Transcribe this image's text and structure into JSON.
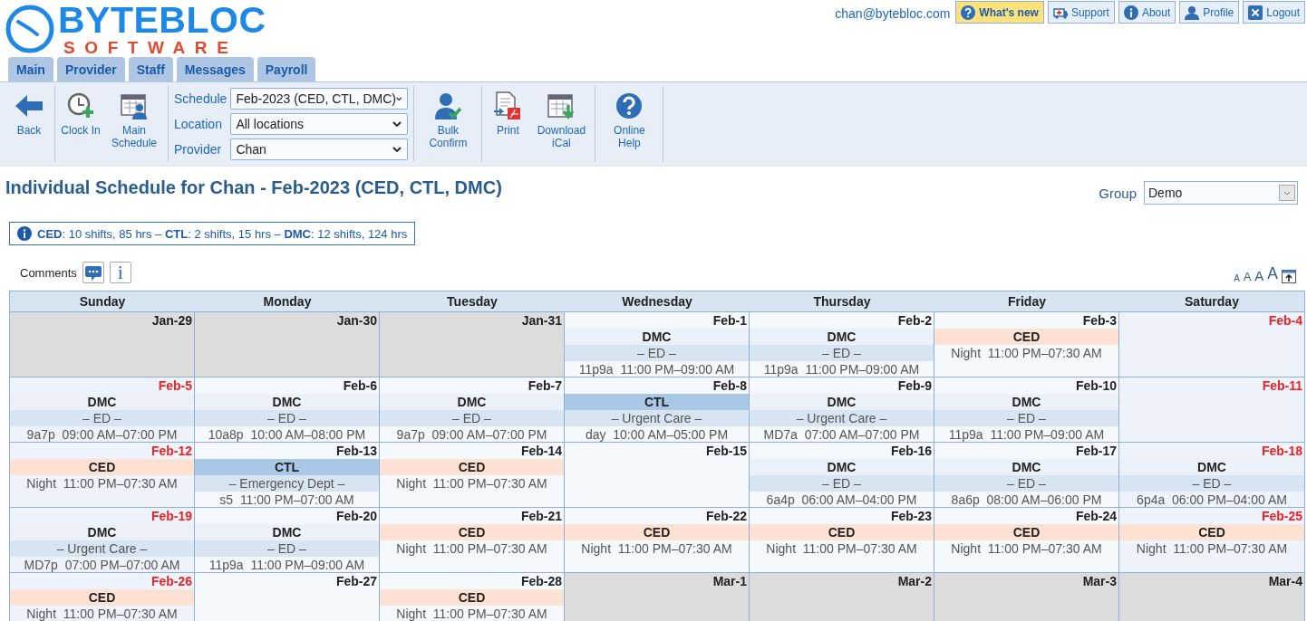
{
  "header": {
    "logo": {
      "title": "BYTEBLOC",
      "subtitle": "SOFTWARE"
    },
    "user_email": "chan@bytebloc.com",
    "buttons": [
      {
        "label": "What's new",
        "highlighted": true
      },
      {
        "label": "Support",
        "highlighted": false
      },
      {
        "label": "About",
        "highlighted": false
      },
      {
        "label": "Profile",
        "highlighted": false
      },
      {
        "label": "Logout",
        "highlighted": false
      }
    ]
  },
  "tabs": [
    {
      "label": "Main",
      "selected": false
    },
    {
      "label": "Provider",
      "selected": false
    },
    {
      "label": "Staff",
      "selected": false
    },
    {
      "label": "Messages",
      "selected": false
    },
    {
      "label": "Payroll",
      "selected": false
    }
  ],
  "toolbar": [
    {
      "kind": "buttons",
      "items": [
        "Back"
      ]
    },
    {
      "kind": "buttons",
      "items": [
        "Clock In",
        "Main Schedule"
      ]
    },
    {
      "kind": "filters",
      "fields": [
        {
          "label": "Schedule",
          "value": "Feb-2023 (CED, CTL, DMC)"
        },
        {
          "label": "Location",
          "value": "All locations"
        },
        {
          "label": "Provider",
          "value": "Chan"
        }
      ]
    },
    {
      "kind": "buttons",
      "items": [
        "Bulk Confirm"
      ]
    },
    {
      "kind": "buttons",
      "items": [
        "Print",
        "Download iCal"
      ]
    },
    {
      "kind": "buttons",
      "items": [
        "Online Help"
      ]
    }
  ],
  "title": "Individual Schedule for Chan - Feb-2023 (CED, CTL, DMC)",
  "group": {
    "label": "Group",
    "value": "Demo"
  },
  "summary": "**CED**: 10 shifts, 85 hrs – **CTL**: 2 shifts, 15 hrs – **DMC**: 12 shifts, 124 hrs",
  "comments": {
    "label": "Comments",
    "info_button": "i"
  },
  "font_size_options": [
    "A",
    "A",
    "A",
    "A"
  ],
  "calendar": {
    "weekdays": [
      "Sunday",
      "Monday",
      "Tuesday",
      "Wednesday",
      "Thursday",
      "Friday",
      "Saturday"
    ],
    "weeks": [
      [
        {
          "date": "Jan-29",
          "weekend": false,
          "outside": true
        },
        {
          "date": "Jan-30",
          "weekend": false,
          "outside": true
        },
        {
          "date": "Jan-31",
          "weekend": false,
          "outside": true
        },
        {
          "date": "Feb-1",
          "weekend": false,
          "outside": false,
          "shifts": [
            {
              "site": "DMC",
              "color": "#eaf1f8",
              "department": "– ED –",
              "code": "11p9a",
              "time": "11:00 PM–09:00 AM"
            }
          ]
        },
        {
          "date": "Feb-2",
          "weekend": false,
          "outside": false,
          "shifts": [
            {
              "site": "DMC",
              "color": "#eaf1f8",
              "department": "– ED –",
              "code": "11p9a",
              "time": "11:00 PM–09:00 AM"
            }
          ]
        },
        {
          "date": "Feb-3",
          "weekend": false,
          "outside": false,
          "shifts": [
            {
              "site": "CED",
              "color": "#fde2d4",
              "code": "Night",
              "time": "11:00 PM–07:30 AM"
            }
          ]
        },
        {
          "date": "Feb-4",
          "weekend": true,
          "outside": false
        }
      ],
      [
        {
          "date": "Feb-5",
          "weekend": true,
          "outside": false,
          "shifts": [
            {
              "site": "DMC",
              "color": "#eaf1f8",
              "department": "– ED –",
              "code": "9a7p",
              "time": "09:00 AM–07:00 PM"
            }
          ]
        },
        {
          "date": "Feb-6",
          "weekend": false,
          "outside": false,
          "shifts": [
            {
              "site": "DMC",
              "color": "#eaf1f8",
              "department": "– ED –",
              "code": "10a8p",
              "time": "10:00 AM–08:00 PM"
            }
          ]
        },
        {
          "date": "Feb-7",
          "weekend": false,
          "outside": false,
          "shifts": [
            {
              "site": "DMC",
              "color": "#eaf1f8",
              "department": "– ED –",
              "code": "9a7p",
              "time": "09:00 AM–07:00 PM"
            }
          ]
        },
        {
          "date": "Feb-8",
          "weekend": false,
          "outside": false,
          "shifts": [
            {
              "site": "CTL",
              "color": "#a9c8e6",
              "department": "– Urgent Care –",
              "code": "day",
              "time": "10:00 AM–05:00 PM"
            }
          ]
        },
        {
          "date": "Feb-9",
          "weekend": false,
          "outside": false,
          "shifts": [
            {
              "site": "DMC",
              "color": "#eaf1f8",
              "department": "– Urgent Care –",
              "code": "MD7a",
              "time": "07:00 AM–07:00 PM"
            }
          ]
        },
        {
          "date": "Feb-10",
          "weekend": false,
          "outside": false,
          "shifts": [
            {
              "site": "DMC",
              "color": "#eaf1f8",
              "department": "– ED –",
              "code": "11p9a",
              "time": "11:00 PM–09:00 AM"
            }
          ]
        },
        {
          "date": "Feb-11",
          "weekend": true,
          "outside": false
        }
      ],
      [
        {
          "date": "Feb-12",
          "weekend": true,
          "outside": false,
          "shifts": [
            {
              "site": "CED",
              "color": "#fde2d4",
              "code": "Night",
              "time": "11:00 PM–07:30 AM"
            }
          ]
        },
        {
          "date": "Feb-13",
          "weekend": false,
          "outside": false,
          "shifts": [
            {
              "site": "CTL",
              "color": "#a9c8e6",
              "department": "– Emergency Dept –",
              "code": "s5",
              "time": "11:00 PM–07:00 AM"
            }
          ]
        },
        {
          "date": "Feb-14",
          "weekend": false,
          "outside": false,
          "shifts": [
            {
              "site": "CED",
              "color": "#fde2d4",
              "code": "Night",
              "time": "11:00 PM–07:30 AM"
            }
          ]
        },
        {
          "date": "Feb-15",
          "weekend": false,
          "outside": false
        },
        {
          "date": "Feb-16",
          "weekend": false,
          "outside": false,
          "shifts": [
            {
              "site": "DMC",
              "color": "#eaf1f8",
              "department": "– ED –",
              "code": "6a4p",
              "time": "06:00 AM–04:00 PM"
            }
          ]
        },
        {
          "date": "Feb-17",
          "weekend": false,
          "outside": false,
          "shifts": [
            {
              "site": "DMC",
              "color": "#eaf1f8",
              "department": "– ED –",
              "code": "8a6p",
              "time": "08:00 AM–06:00 PM"
            }
          ]
        },
        {
          "date": "Feb-18",
          "weekend": true,
          "outside": false,
          "shifts": [
            {
              "site": "DMC",
              "color": "#eaf1f8",
              "department": "– ED –",
              "code": "6p4a",
              "time": "06:00 PM–04:00 AM"
            }
          ]
        }
      ],
      [
        {
          "date": "Feb-19",
          "weekend": true,
          "outside": false,
          "shifts": [
            {
              "site": "DMC",
              "color": "#eaf1f8",
              "department": "– Urgent Care –",
              "code": "MD7p",
              "time": "07:00 PM–07:00 AM"
            }
          ]
        },
        {
          "date": "Feb-20",
          "weekend": false,
          "outside": false,
          "shifts": [
            {
              "site": "DMC",
              "color": "#eaf1f8",
              "department": "– ED –",
              "code": "11p9a",
              "time": "11:00 PM–09:00 AM"
            }
          ]
        },
        {
          "date": "Feb-21",
          "weekend": false,
          "outside": false,
          "shifts": [
            {
              "site": "CED",
              "color": "#fde2d4",
              "code": "Night",
              "time": "11:00 PM–07:30 AM"
            }
          ]
        },
        {
          "date": "Feb-22",
          "weekend": false,
          "outside": false,
          "shifts": [
            {
              "site": "CED",
              "color": "#fde2d4",
              "code": "Night",
              "time": "11:00 PM–07:30 AM"
            }
          ]
        },
        {
          "date": "Feb-23",
          "weekend": false,
          "outside": false,
          "shifts": [
            {
              "site": "CED",
              "color": "#fde2d4",
              "code": "Night",
              "time": "11:00 PM–07:30 AM"
            }
          ]
        },
        {
          "date": "Feb-24",
          "weekend": false,
          "outside": false,
          "shifts": [
            {
              "site": "CED",
              "color": "#fde2d4",
              "code": "Night",
              "time": "11:00 PM–07:30 AM"
            }
          ]
        },
        {
          "date": "Feb-25",
          "weekend": true,
          "outside": false,
          "shifts": [
            {
              "site": "CED",
              "color": "#fde2d4",
              "code": "Night",
              "time": "11:00 PM–07:30 AM"
            }
          ]
        }
      ],
      [
        {
          "date": "Feb-26",
          "weekend": true,
          "outside": false,
          "shifts": [
            {
              "site": "CED",
              "color": "#fde2d4",
              "code": "Night",
              "time": "11:00 PM–07:30 AM"
            }
          ]
        },
        {
          "date": "Feb-27",
          "weekend": false,
          "outside": false
        },
        {
          "date": "Feb-28",
          "weekend": false,
          "outside": false,
          "shifts": [
            {
              "site": "CED",
              "color": "#fde2d4",
              "code": "Night",
              "time": "11:00 PM–07:30 AM"
            }
          ]
        },
        {
          "date": "Mar-1",
          "weekend": false,
          "outside": true
        },
        {
          "date": "Mar-2",
          "weekend": false,
          "outside": true
        },
        {
          "date": "Mar-3",
          "weekend": false,
          "outside": true
        },
        {
          "date": "Mar-4",
          "weekend": false,
          "outside": true
        }
      ]
    ]
  }
}
